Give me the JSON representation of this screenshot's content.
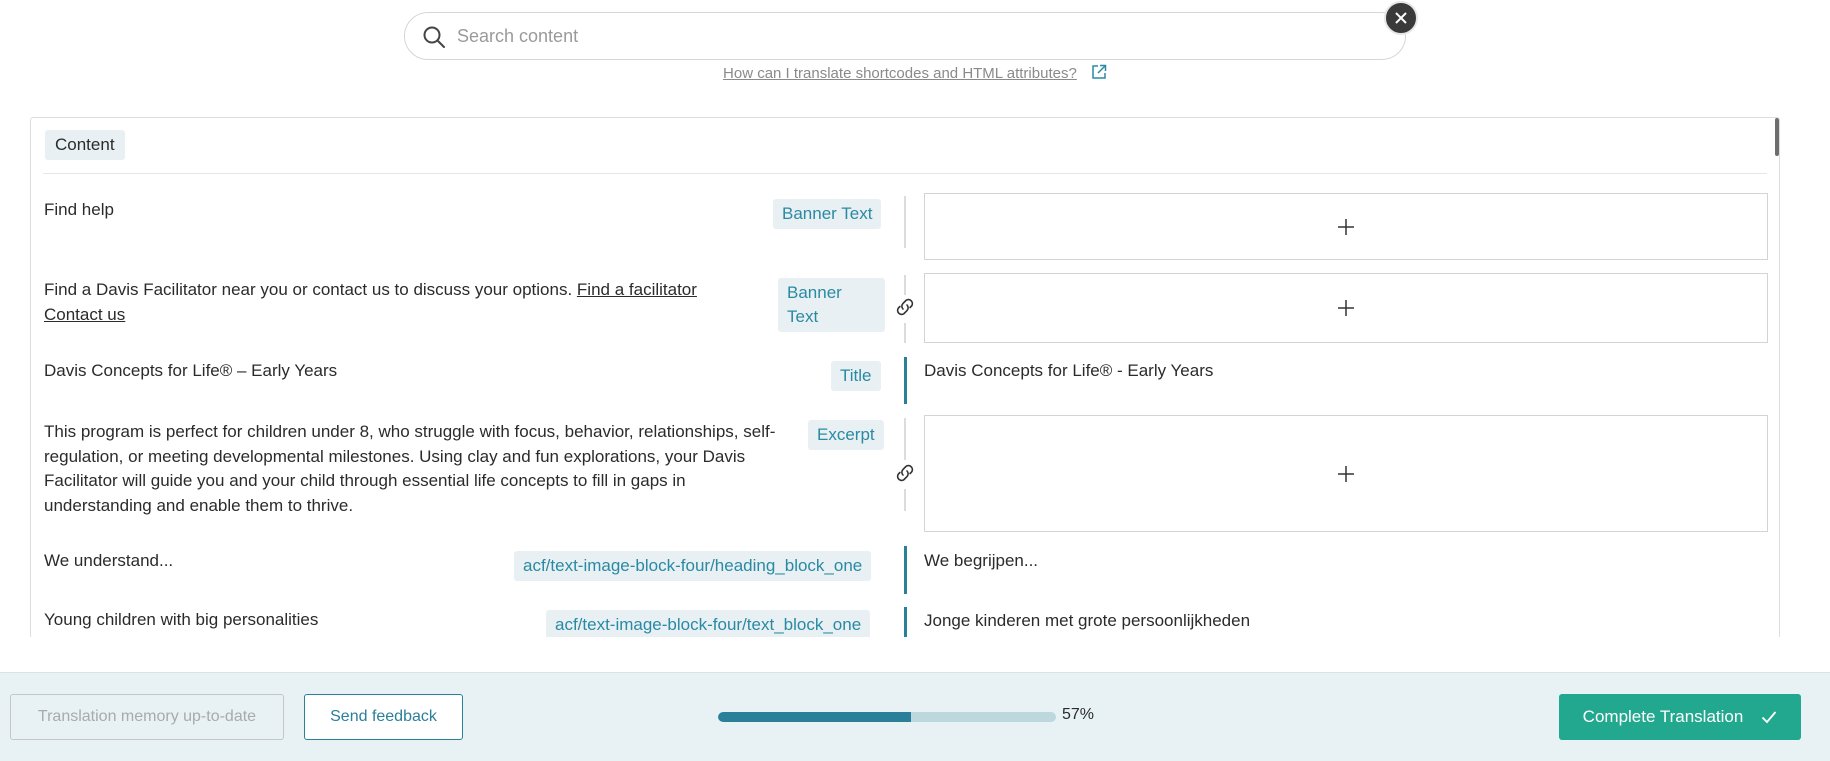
{
  "search": {
    "placeholder": "Search content"
  },
  "help": {
    "link_text": "How can I translate shortcodes and HTML attributes?"
  },
  "section": {
    "label": "Content"
  },
  "rows": [
    {
      "source_text": "Find help",
      "tag": "Banner Text",
      "target": null,
      "linked": false
    },
    {
      "source_text": "Find a Davis Facilitator near you or contact us to discuss your options.",
      "source_link1": "Find a facilitator",
      "source_link2": "Contact us",
      "tag_line1": "Banner",
      "tag_line2": "Text",
      "target": null,
      "linked": true
    },
    {
      "source_text": "Davis Concepts for Life® – Early Years",
      "tag": "Title",
      "target": "Davis Concepts for Life® - Early Years",
      "linked": false
    },
    {
      "source_text_lines": [
        "This program is perfect for children under 8, who struggle with focus, behavior, relationships, self-",
        "regulation, or meeting developmental milestones. Using clay and fun explorations, your Davis",
        "Facilitator will guide you and your child through essential life concepts to fill in gaps in",
        "understanding and enable them to thrive."
      ],
      "tag": "Excerpt",
      "target": null,
      "linked": true
    },
    {
      "source_text": "We understand...",
      "tag": "acf/text-image-block-four/heading_block_one",
      "target": "We begrijpen...",
      "linked": false
    },
    {
      "source_text": "Young children with big personalities",
      "tag": "acf/text-image-block-four/text_block_one",
      "target": "Jonge kinderen met grote persoonlijkheden",
      "linked": false
    }
  ],
  "footer": {
    "memory_button": "Translation memory up-to-date",
    "feedback_button": "Send feedback",
    "progress": 57,
    "progress_label": "57%",
    "complete_button": "Complete Translation"
  },
  "colors": {
    "accent": "#2a7f99",
    "tag_text": "#2a8aa3",
    "tag_bg": "#e8f0f3",
    "complete_green": "#22a88f",
    "footer_bg": "#e8f2f4"
  },
  "icons": [
    "search-icon",
    "close-icon",
    "external-link-icon",
    "link-icon",
    "plus-icon",
    "check-icon"
  ]
}
